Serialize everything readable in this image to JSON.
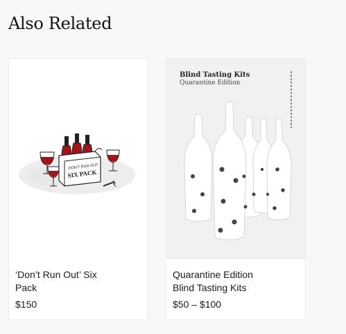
{
  "section": {
    "title": "Also Related"
  },
  "products": [
    {
      "name_line1": "‘Don’t Run Out’ Six",
      "name_line2": "Pack",
      "price": "$150",
      "crate_text_1": "DON'T RUN OUT",
      "crate_text_2": "SIX PACK",
      "image": "six-pack-illustration"
    },
    {
      "name_line1": "Quarantine Edition",
      "name_line2": "Blind Tasting Kits",
      "price": "$50 – $100",
      "poster_title": "Blind Tasting Kits",
      "poster_subtitle": "Quarantine Edition",
      "image": "wrapped-bottles-photo"
    }
  ],
  "colors": {
    "wine": "#a3131a",
    "background": "#f8f8f8",
    "card": "#ffffff"
  }
}
